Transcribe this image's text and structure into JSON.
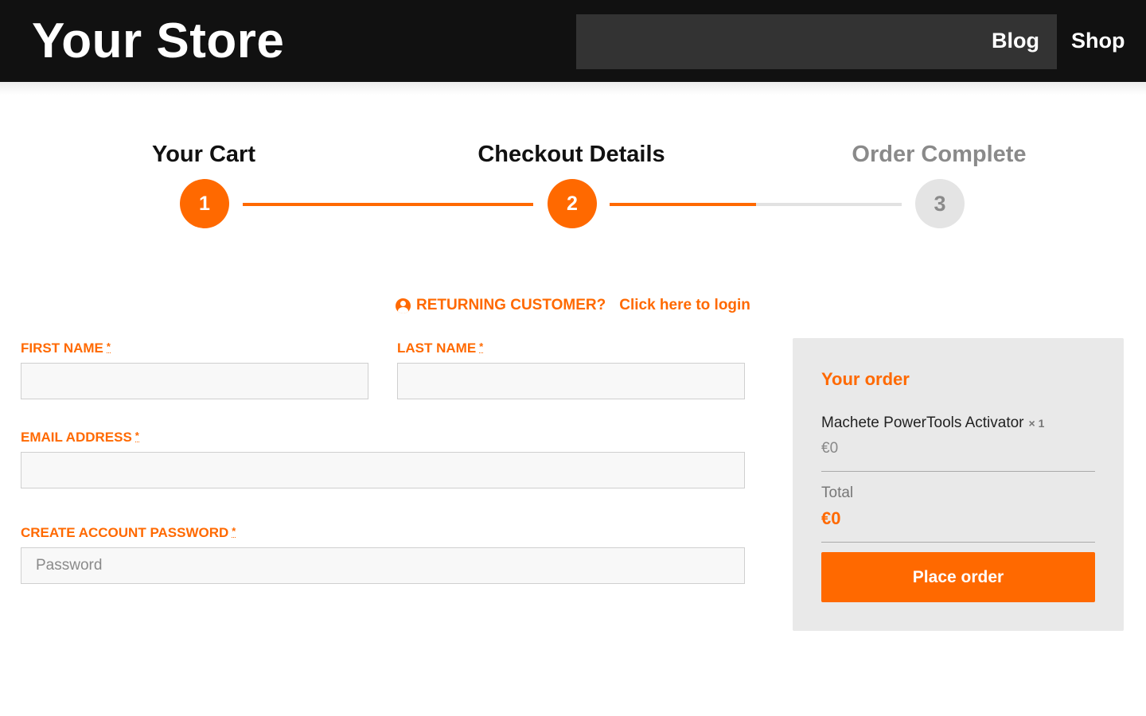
{
  "header": {
    "logo": "Your Store",
    "nav": [
      "Blog",
      "Shop"
    ]
  },
  "steps": [
    {
      "title": "Your Cart",
      "number": "1",
      "state": "done"
    },
    {
      "title": "Checkout Details",
      "number": "2",
      "state": "active"
    },
    {
      "title": "Order Complete",
      "number": "3",
      "state": "pending"
    }
  ],
  "login_prompt": {
    "text": "RETURNING CUSTOMER?",
    "link": "Click here to login"
  },
  "form": {
    "first_name_label": "FIRST NAME",
    "last_name_label": "LAST NAME",
    "email_label": "EMAIL ADDRESS",
    "password_label": "CREATE ACCOUNT PASSWORD",
    "password_placeholder": "Password",
    "required_mark": "*"
  },
  "order": {
    "title": "Your order",
    "item_name": "Machete PowerTools Activator",
    "item_qty": "× 1",
    "item_price": "€0",
    "total_label": "Total",
    "total_value": "€0",
    "place_order": "Place order"
  },
  "colors": {
    "accent": "#ff6900",
    "header_bg": "#111111",
    "panel_bg": "#e9e9e9"
  }
}
